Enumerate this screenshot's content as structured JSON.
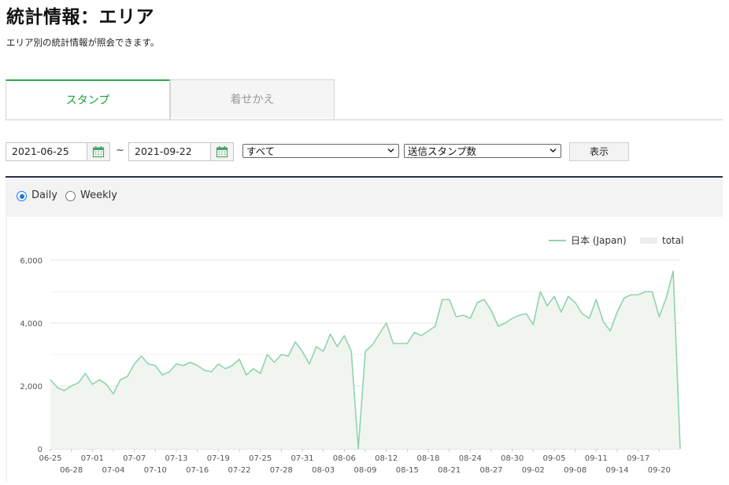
{
  "header": {
    "title": "統計情報：エリア",
    "description": "エリア別の統計情報が照会できます。"
  },
  "tabs": [
    {
      "label": "スタンプ",
      "active": true
    },
    {
      "label": "着せかえ",
      "active": false
    }
  ],
  "filters": {
    "start_date": "2021-06-25",
    "end_date": "2021-09-22",
    "separator": "~",
    "area_select": "すべて",
    "metric_select": "送信スタンプ数",
    "show_button": "表示"
  },
  "period_options": [
    {
      "label": "Daily",
      "selected": true
    },
    {
      "label": "Weekly",
      "selected": false
    }
  ],
  "colors": {
    "accent_green": "#1e9e3e",
    "line": "#8fd3ad",
    "area_fill": "#f1f5f0",
    "radio_blue": "#1a73e8"
  },
  "chart_data": {
    "type": "line",
    "ylim": [
      0,
      6000
    ],
    "yticks": [
      "0",
      "2,000",
      "4,000",
      "6,000"
    ],
    "legend": [
      {
        "name": "日本 (Japan)",
        "style": "line"
      },
      {
        "name": "total",
        "style": "area"
      }
    ],
    "x_labels_upper": [
      "06-25",
      "07-01",
      "07-07",
      "07-13",
      "07-19",
      "07-25",
      "07-31",
      "08-06",
      "08-12",
      "08-18",
      "08-24",
      "08-30",
      "09-05",
      "09-11",
      "09-17"
    ],
    "x_labels_lower": [
      "06-28",
      "07-04",
      "07-10",
      "07-16",
      "07-22",
      "07-28",
      "08-03",
      "08-09",
      "08-15",
      "08-21",
      "08-27",
      "09-02",
      "09-08",
      "09-14",
      "09-20"
    ],
    "x_start": "06-25",
    "x_end": "09-22",
    "series": [
      {
        "name": "日本 (Japan)",
        "values": [
          2200,
          1950,
          1850,
          2000,
          2100,
          2400,
          2050,
          2200,
          2050,
          1750,
          2200,
          2300,
          2700,
          2950,
          2700,
          2650,
          2350,
          2450,
          2700,
          2650,
          2750,
          2650,
          2500,
          2450,
          2700,
          2550,
          2650,
          2850,
          2350,
          2550,
          2400,
          3000,
          2750,
          3000,
          2950,
          3400,
          3100,
          2700,
          3250,
          3100,
          3650,
          3250,
          3600,
          3100,
          0,
          3100,
          3300,
          3650,
          4000,
          3350,
          3350,
          3350,
          3700,
          3600,
          3750,
          3900,
          4750,
          4750,
          4200,
          4250,
          4150,
          4650,
          4750,
          4400,
          3900,
          4000,
          4150,
          4250,
          4300,
          3950,
          5000,
          4550,
          4850,
          4350,
          4850,
          4650,
          4300,
          4150,
          4750,
          4050,
          3750,
          4350,
          4800,
          4900,
          4900,
          5000,
          5000,
          4200,
          4800,
          5650,
          0
        ]
      }
    ]
  }
}
